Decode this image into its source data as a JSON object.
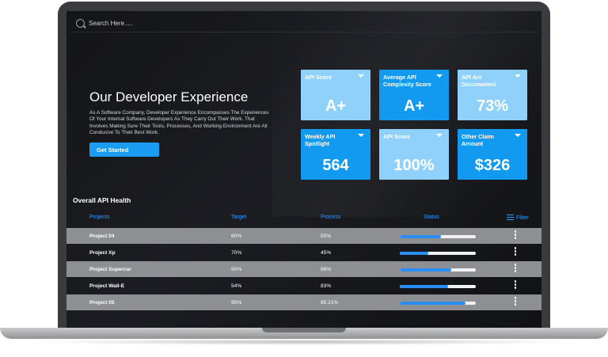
{
  "search": {
    "placeholder": "Search Here....."
  },
  "hero": {
    "title": "Our Developer Experience",
    "description": "As A Software Company, Developer Experience Encompasses The Experiences Of Your Internal Software Developers As They Carry Out Their Work. That Involves Making Sure Their Tools, Processes, And Working Environment Are All Conducive To Their Best Work.",
    "button_label": "Get Started"
  },
  "cards": [
    {
      "label": "API Score",
      "value": "A+",
      "style": "light"
    },
    {
      "label": "Average API Complexity Score",
      "value": "A+",
      "style": "dark"
    },
    {
      "label": "API Are Documented",
      "value": "73%",
      "style": "light"
    },
    {
      "label": "Weekly API Spotlight",
      "value": "564",
      "style": "dark"
    },
    {
      "label": "API Score",
      "value": "100%",
      "style": "light"
    },
    {
      "label": "Other Claim Amount",
      "value": "$326",
      "style": "dark"
    }
  ],
  "health": {
    "title": "Overall API Health",
    "columns": {
      "projects": "Projects",
      "target": "Target",
      "process": "Process",
      "status": "Status",
      "filter": "Filter"
    },
    "rows": [
      {
        "project": "Project 04",
        "target": "60%",
        "process": "50%",
        "status": 0.54
      },
      {
        "project": "Project Xp",
        "target": "70%",
        "process": "45%",
        "status": 0.38
      },
      {
        "project": "Project Supercar",
        "target": "90%",
        "process": "86%",
        "status": 0.68
      },
      {
        "project": "Project Wall-E",
        "target": "54%",
        "process": "83%",
        "status": 0.64
      },
      {
        "project": "Project 05",
        "target": "95%",
        "process": "85.21%",
        "status": 0.86
      }
    ]
  },
  "colors": {
    "accent": "#1a9cf0",
    "card_light": "#8fd1fb",
    "card_dark": "#1299f0",
    "row_shade": "#8e8f93",
    "bar_fill": "#2a8ef7"
  }
}
